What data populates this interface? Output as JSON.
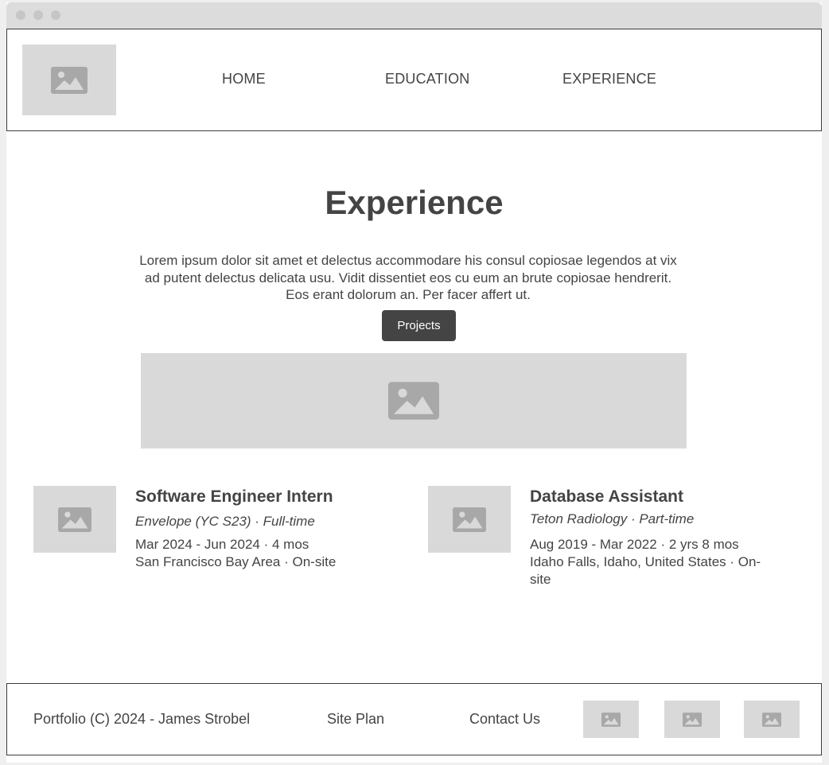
{
  "nav": {
    "home": "HOME",
    "education": "EDUCATION",
    "experience": "EXPERIENCE"
  },
  "main": {
    "title": "Experience",
    "intro": "Lorem ipsum dolor sit amet et delectus accommodare his consul copiosae legendos at vix ad putent delectus delicata usu. Vidit dissentiet eos cu eum an brute copiosae hendrerit. Eos erant dolorum an. Per facer affert ut.",
    "projects_button": "Projects"
  },
  "jobs": [
    {
      "title": "Software Engineer Intern",
      "company": "Envelope (YC S23) · Full-time",
      "dates": "Mar 2024 - Jun 2024 · 4 mos",
      "location": "San Francisco Bay Area · On-site"
    },
    {
      "title": "Database Assistant",
      "company": "Teton Radiology · Part-time",
      "dates": "Aug 2019 - Mar 2022 · 2 yrs 8 mos",
      "location": "Idaho Falls, Idaho, United States · On-site"
    }
  ],
  "footer": {
    "copyright": "Portfolio (C) 2024 - James Strobel",
    "site_plan": "Site Plan",
    "contact": "Contact Us"
  },
  "icons": {
    "placeholder": "image-icon",
    "window_controls": "window-dot"
  },
  "colors": {
    "placeholder_bg": "#d9d9d9",
    "placeholder_icon": "#a8a8a8",
    "text": "#444444",
    "button_bg": "#444444"
  }
}
